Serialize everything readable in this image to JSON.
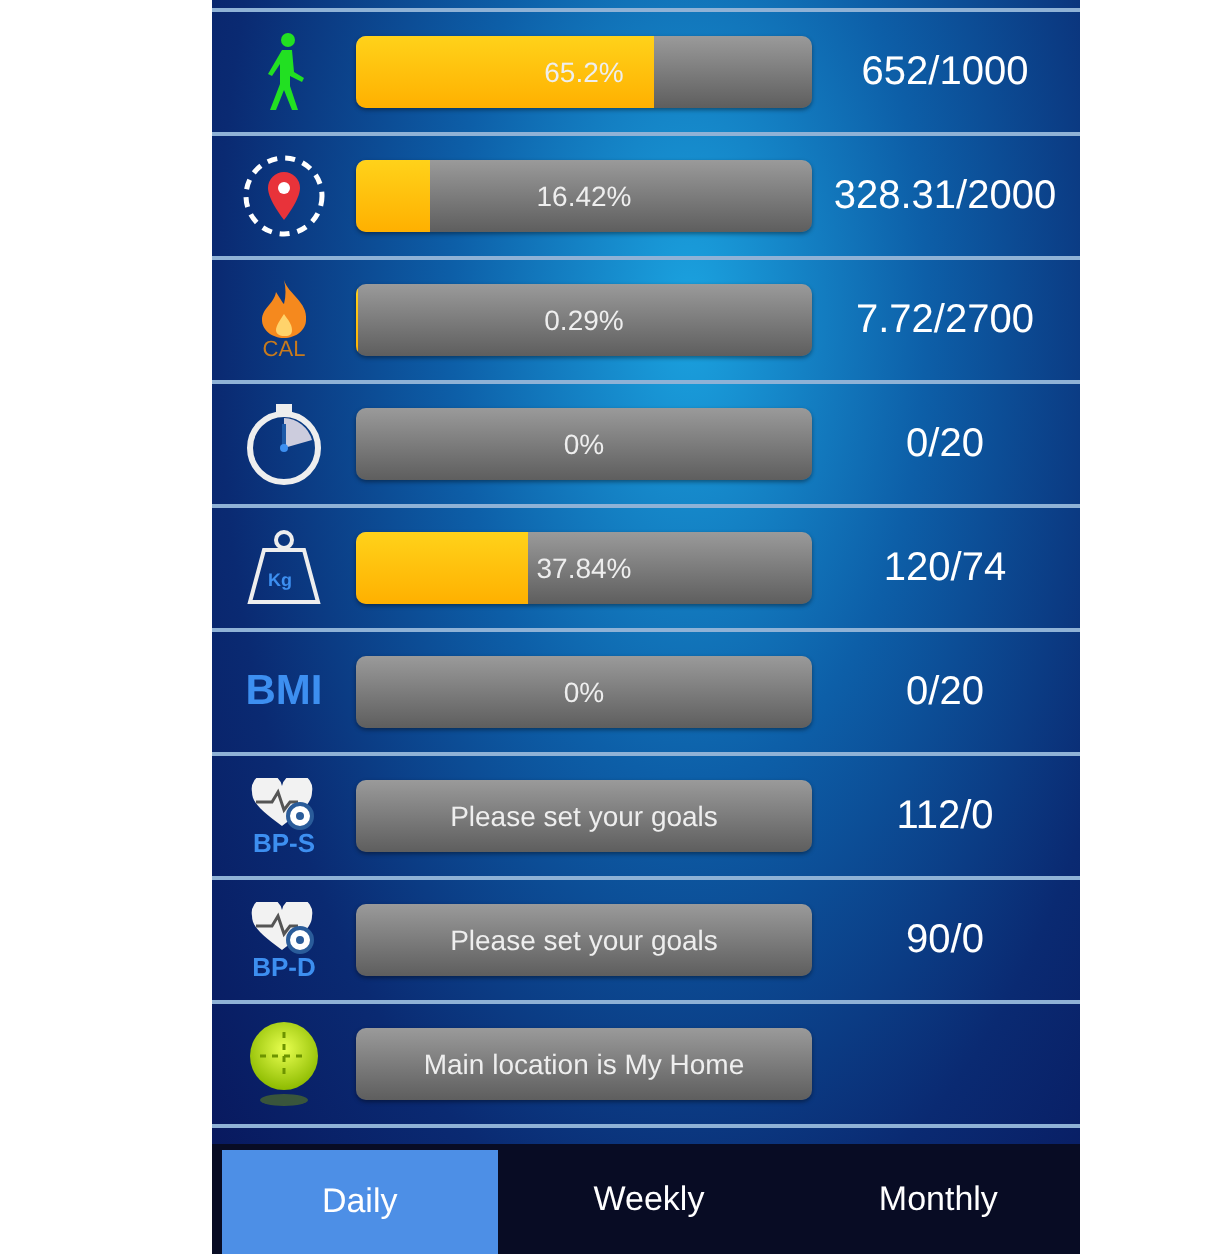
{
  "rows": [
    {
      "kind": "progress",
      "level": 0.652,
      "bar_text": "65.2%",
      "value": "652/1000"
    },
    {
      "kind": "progress",
      "level": 0.1642,
      "bar_text": "16.42%",
      "value": "328.31/2000"
    },
    {
      "icon_label": "CAL",
      "kind": "progress",
      "level": 0.0029,
      "bar_text": "0.29%",
      "value": "7.72/2700"
    },
    {
      "kind": "progress",
      "level": 0,
      "bar_text": "0%",
      "value": "0/20"
    },
    {
      "icon_label": "Kg",
      "kind": "progress",
      "level": 0.3784,
      "bar_text": "37.84%",
      "value": "120/74"
    },
    {
      "icon_label": "BMI",
      "kind": "progress",
      "level": 0,
      "bar_text": "0%",
      "value": "0/20"
    },
    {
      "icon_label": "BP-S",
      "kind": "message",
      "bar_text": "Please set your goals",
      "value": "112/0"
    },
    {
      "icon_label": "BP-D",
      "kind": "message",
      "bar_text": "Please set your goals",
      "value": "90/0"
    },
    {
      "kind": "message",
      "bar_text": "Main location is My Home"
    }
  ],
  "tabs": [
    {
      "label": "Daily",
      "selected": true
    },
    {
      "label": "Weekly",
      "selected": false
    },
    {
      "label": "Monthly",
      "selected": false
    }
  ]
}
